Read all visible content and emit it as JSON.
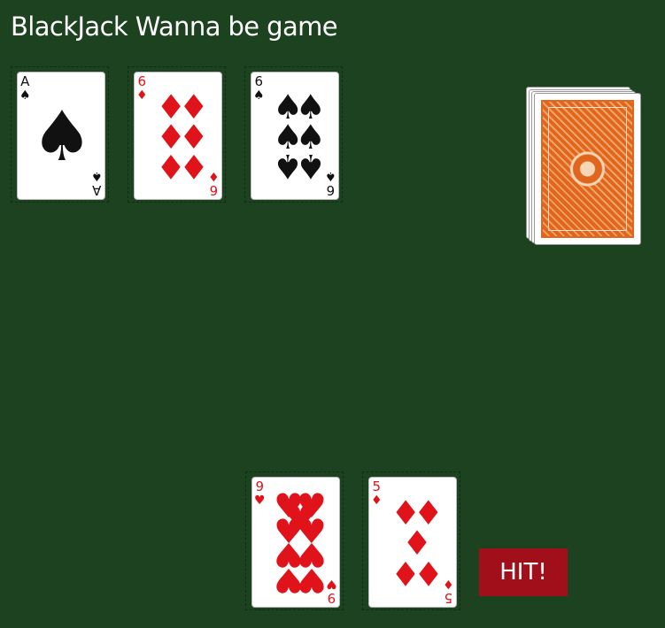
{
  "title": "BlackJack Wanna be game",
  "dealer_hand": [
    {
      "rank": "A",
      "suit": "♠",
      "suit_name": "spades",
      "color": "black"
    },
    {
      "rank": "6",
      "suit": "♦",
      "suit_name": "diamonds",
      "color": "red"
    },
    {
      "rank": "6",
      "suit": "♠",
      "suit_name": "spades",
      "color": "black"
    }
  ],
  "player_hand": [
    {
      "rank": "9",
      "suit": "♥",
      "suit_name": "hearts",
      "color": "red"
    },
    {
      "rank": "5",
      "suit": "♦",
      "suit_name": "diamonds",
      "color": "red"
    }
  ],
  "deck": {
    "back_color": "#e0661e"
  },
  "controls": {
    "hit_label": "HIT!"
  },
  "colors": {
    "table": "#1d4220",
    "red_suit": "#e0131b",
    "hit_button": "#a1101a"
  }
}
